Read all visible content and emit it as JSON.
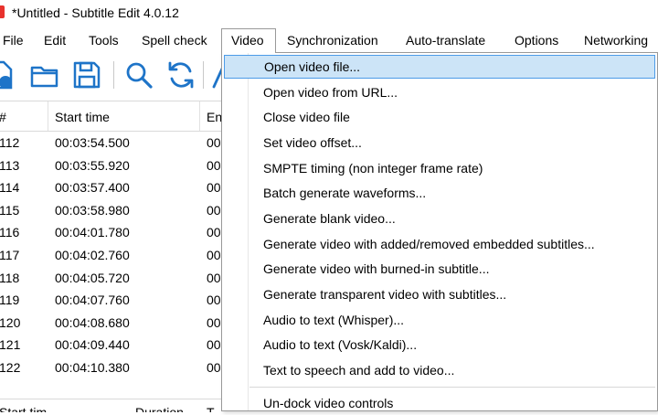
{
  "window": {
    "title": "*Untitled - Subtitle Edit 4.0.12"
  },
  "menubar": {
    "items": [
      {
        "label": "File"
      },
      {
        "label": "Edit"
      },
      {
        "label": "Tools"
      },
      {
        "label": "Spell check"
      },
      {
        "label": "Video"
      },
      {
        "label": "Synchronization"
      },
      {
        "label": "Auto-translate"
      },
      {
        "label": "Options"
      },
      {
        "label": "Networking"
      }
    ]
  },
  "toolbar": {
    "icons": [
      "new-file-icon",
      "open-folder-icon",
      "save-icon",
      "find-icon",
      "replace-icon",
      "next-icon"
    ]
  },
  "grid": {
    "columns": {
      "number": "#",
      "start": "Start time",
      "end": "En"
    },
    "rows": [
      {
        "num": "112",
        "start": "00:03:54.500",
        "end": "00"
      },
      {
        "num": "113",
        "start": "00:03:55.920",
        "end": "00"
      },
      {
        "num": "114",
        "start": "00:03:57.400",
        "end": "00"
      },
      {
        "num": "115",
        "start": "00:03:58.980",
        "end": "00"
      },
      {
        "num": "116",
        "start": "00:04:01.780",
        "end": "00"
      },
      {
        "num": "117",
        "start": "00:04:02.760",
        "end": "00"
      },
      {
        "num": "118",
        "start": "00:04:05.720",
        "end": "00"
      },
      {
        "num": "119",
        "start": "00:04:07.760",
        "end": "00"
      },
      {
        "num": "120",
        "start": "00:04:08.680",
        "end": "00"
      },
      {
        "num": "121",
        "start": "00:04:09.440",
        "end": "00"
      },
      {
        "num": "122",
        "start": "00:04:10.380",
        "end": "00"
      }
    ],
    "bottom_header": {
      "start": "Start tim",
      "duration": "Duration",
      "t": "T"
    }
  },
  "video_menu": {
    "items": [
      {
        "label": "Open video file...",
        "highlighted": true
      },
      {
        "label": "Open video from URL..."
      },
      {
        "label": "Close video file"
      },
      {
        "label": "Set video offset..."
      },
      {
        "label": "SMPTE timing (non integer frame rate)"
      },
      {
        "label": "Batch generate waveforms..."
      },
      {
        "label": "Generate blank video..."
      },
      {
        "label": "Generate video with added/removed embedded subtitles..."
      },
      {
        "label": "Generate video with burned-in subtitle..."
      },
      {
        "label": "Generate transparent video with subtitles..."
      },
      {
        "label": "Audio to text (Whisper)..."
      },
      {
        "label": "Audio to text (Vosk/Kaldi)..."
      },
      {
        "label": "Text to speech and add to video..."
      }
    ],
    "after_separator": [
      {
        "label": "Un-dock video controls"
      }
    ]
  },
  "colors": {
    "highlight_bg": "#cce4f7",
    "highlight_border": "#4c9be8",
    "icon_blue": "#1e74c8",
    "app_icon": "#e8322d"
  }
}
